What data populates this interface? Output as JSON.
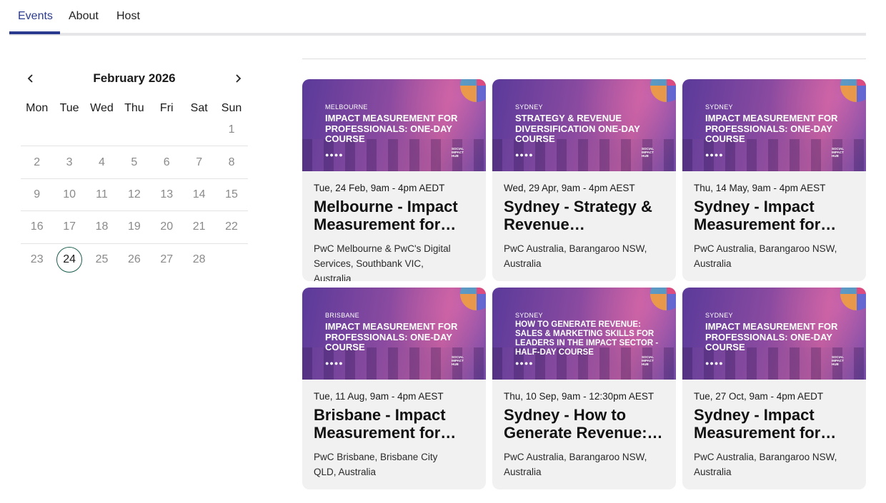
{
  "tabs": [
    {
      "label": "Events"
    },
    {
      "label": "About"
    },
    {
      "label": "Host"
    }
  ],
  "calendar": {
    "month_label": "February 2026",
    "prev_icon": "chevron-left-icon",
    "next_icon": "chevron-right-icon",
    "weekdays": [
      "Mon",
      "Tue",
      "Wed",
      "Thu",
      "Fri",
      "Sat",
      "Sun"
    ],
    "weeks": [
      [
        "",
        "",
        "",
        "",
        "",
        "",
        "1"
      ],
      [
        "2",
        "3",
        "4",
        "5",
        "6",
        "7",
        "8"
      ],
      [
        "9",
        "10",
        "11",
        "12",
        "13",
        "14",
        "15"
      ],
      [
        "16",
        "17",
        "18",
        "19",
        "20",
        "21",
        "22"
      ],
      [
        "23",
        "24",
        "25",
        "26",
        "27",
        "28",
        ""
      ]
    ],
    "today": "24"
  },
  "events": [
    {
      "banner_city": "MELBOURNE",
      "banner_title": "IMPACT MEASUREMENT FOR PROFESSIONALS: ONE-DAY COURSE",
      "banner_dots": "●●●●",
      "banner_logo": "SOCIAL IMPACT HUB",
      "date": "Tue, 24 Feb, 9am - 4pm AEDT",
      "title": "Melbourne - Impact Measurement for Professionals: One-Day Course",
      "location": "PwC Melbourne & PwC's Digital Services, Southbank VIC, Australia"
    },
    {
      "banner_city": "SYDNEY",
      "banner_title": "STRATEGY & REVENUE DIVERSIFICATION ONE-DAY COURSE",
      "banner_dots": "●●●●",
      "banner_logo": "SOCIAL IMPACT HUB",
      "date": "Wed, 29 Apr, 9am - 4pm AEST",
      "title": "Sydney - Strategy & Revenue Diversification One-Day Course",
      "location": "PwC Australia, Barangaroo NSW, Australia"
    },
    {
      "banner_city": "SYDNEY",
      "banner_title": "IMPACT MEASUREMENT FOR PROFESSIONALS: ONE-DAY COURSE",
      "banner_dots": "●●●●",
      "banner_logo": "SOCIAL IMPACT HUB",
      "date": "Thu, 14 May, 9am - 4pm AEST",
      "title": "Sydney - Impact Measurement for Professionals: One-Day Course",
      "location": "PwC Australia, Barangaroo NSW, Australia"
    },
    {
      "banner_city": "BRISBANE",
      "banner_title": "IMPACT MEASUREMENT FOR PROFESSIONALS: ONE-DAY COURSE",
      "banner_dots": "●●●●",
      "banner_logo": "SOCIAL IMPACT HUB",
      "date": "Tue, 11 Aug, 9am - 4pm AEST",
      "title": "Brisbane - Impact Measurement for Professionals: One-Day Course",
      "location": "PwC Brisbane, Brisbane City QLD, Australia"
    },
    {
      "banner_city": "SYDNEY",
      "banner_title": "HOW TO GENERATE REVENUE: SALES & MARKETING SKILLS FOR LEADERS IN THE IMPACT SECTOR - HALF-DAY COURSE",
      "banner_dots": "●●●●",
      "banner_logo": "SOCIAL IMPACT HUB",
      "date": "Thu, 10 Sep, 9am - 12:30pm AEST",
      "title": "Sydney - How to Generate Revenue: Sales & Marketing Skills for Leaders in the Impact Sector",
      "location": "PwC Australia, Barangaroo NSW, Australia"
    },
    {
      "banner_city": "SYDNEY",
      "banner_title": "IMPACT MEASUREMENT FOR PROFESSIONALS: ONE-DAY COURSE",
      "banner_dots": "●●●●",
      "banner_logo": "SOCIAL IMPACT HUB",
      "date": "Tue, 27 Oct, 9am - 4pm AEDT",
      "title": "Sydney - Impact Measurement for Professionals: One-Day Course",
      "location": "PwC Australia, Barangaroo NSW, Australia"
    }
  ],
  "colors": {
    "accent": "#2a3b8f",
    "today_ring": "#1d5e50",
    "card_bg": "#f1f1f2"
  }
}
